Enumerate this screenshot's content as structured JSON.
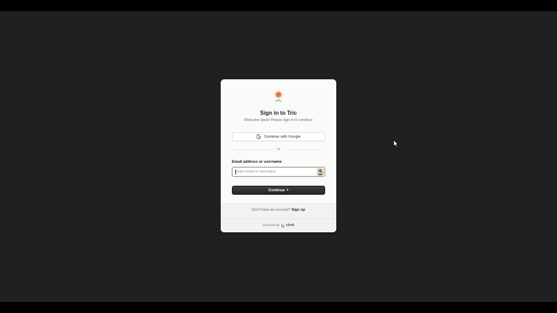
{
  "signin": {
    "title": "Sign in to Tric",
    "subtitle": "Welcome back! Please sign in to continue",
    "google_label": "Continue with Google",
    "divider_text": "or",
    "field_label": "Email address or username",
    "input_placeholder": "Enter email or username",
    "input_value": "",
    "continue_label": "Continue",
    "continue_arrow": "▸"
  },
  "footer": {
    "no_account_text": "Don't have an account?",
    "signup_label": "Sign up",
    "secured_by": "Secured by",
    "provider_name": "clerk"
  },
  "icons": {
    "logo": "sun-flower-logo-icon",
    "google": "google-icon",
    "autofill": "password-manager-autofill-icon",
    "clerk": "clerk-icon",
    "cursor": "mouse-pointer-icon"
  },
  "colors": {
    "background": "#202020",
    "card": "#fafaf8",
    "primary_button": "#2e2e2e",
    "logo_orange": "#e8894a",
    "logo_green": "#6fae7a"
  }
}
